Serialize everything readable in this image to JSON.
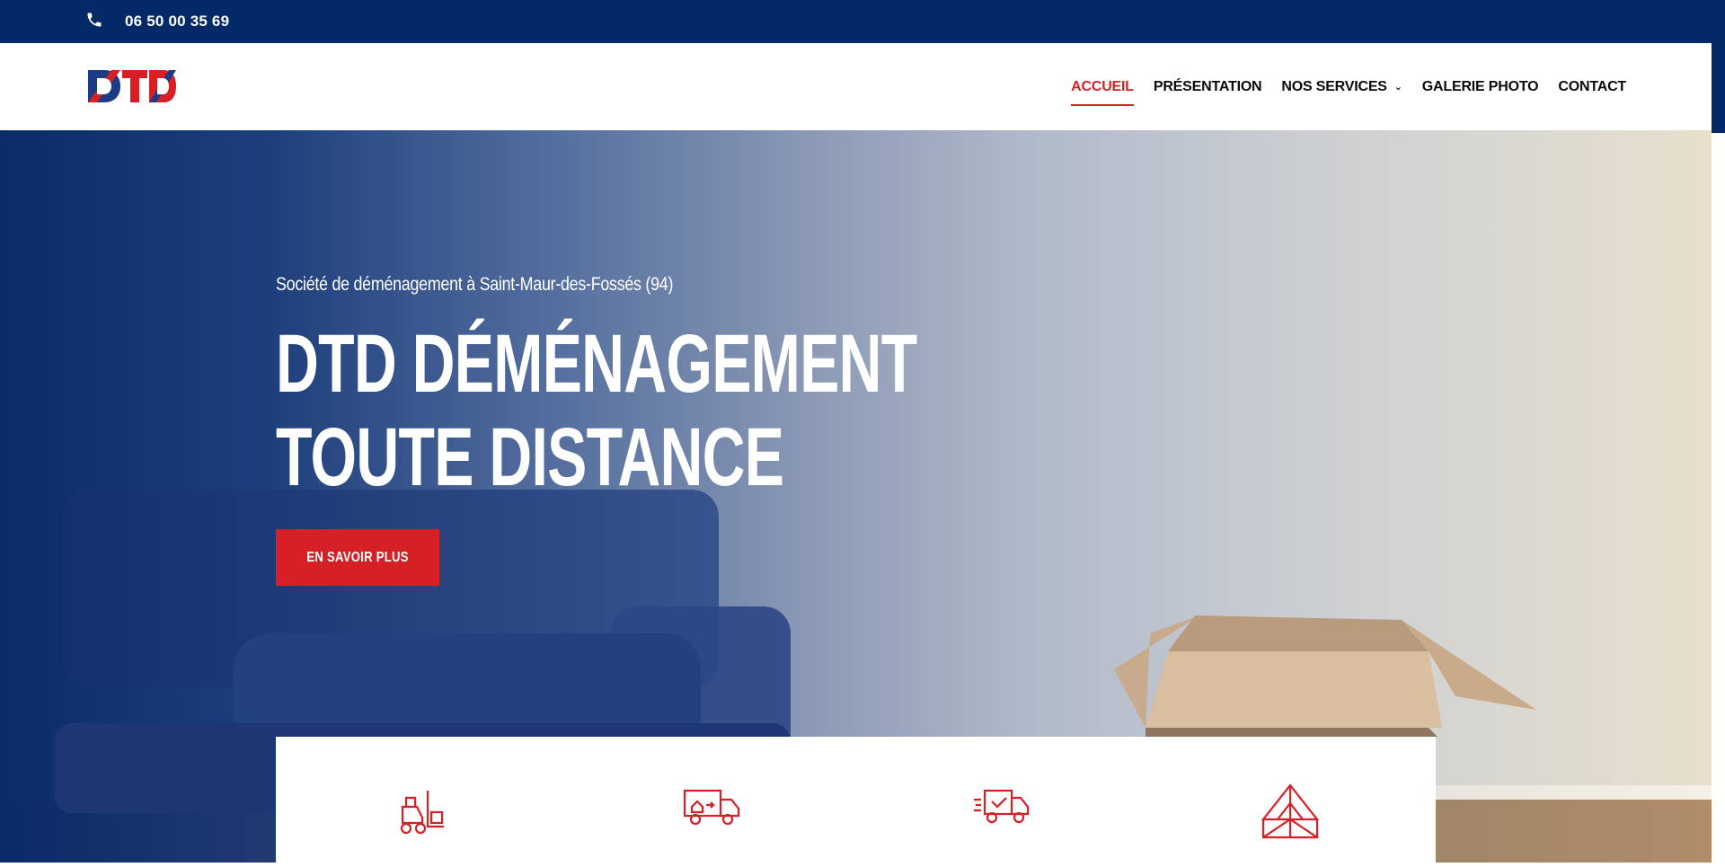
{
  "topbar": {
    "phone": "06 50 00 35 69",
    "icon": "phone-icon"
  },
  "header": {
    "logo_text": "DTD",
    "nav": [
      {
        "label": "ACCUEIL",
        "active": true
      },
      {
        "label": "PRÉSENTATION",
        "active": false
      },
      {
        "label": "NOS SERVICES",
        "active": false,
        "has_dropdown": true
      },
      {
        "label": "GALERIE PHOTO",
        "active": false
      },
      {
        "label": "CONTACT",
        "active": false
      }
    ]
  },
  "hero": {
    "subtitle": "Société de déménagement à Saint-Maur-des-Fossés (94)",
    "title_line1": "DTD DÉMÉNAGEMENT",
    "title_line2": "TOUTE DISTANCE",
    "cta_label": "EN SAVOIR PLUS"
  },
  "services": {
    "icons": [
      "forklift-icon",
      "moving-truck-icon",
      "delivery-truck-icon",
      "roof-truss-icon"
    ]
  },
  "colors": {
    "navy": "#032967",
    "red": "#d71f26",
    "white": "#ffffff",
    "text": "#0b0b0b"
  }
}
